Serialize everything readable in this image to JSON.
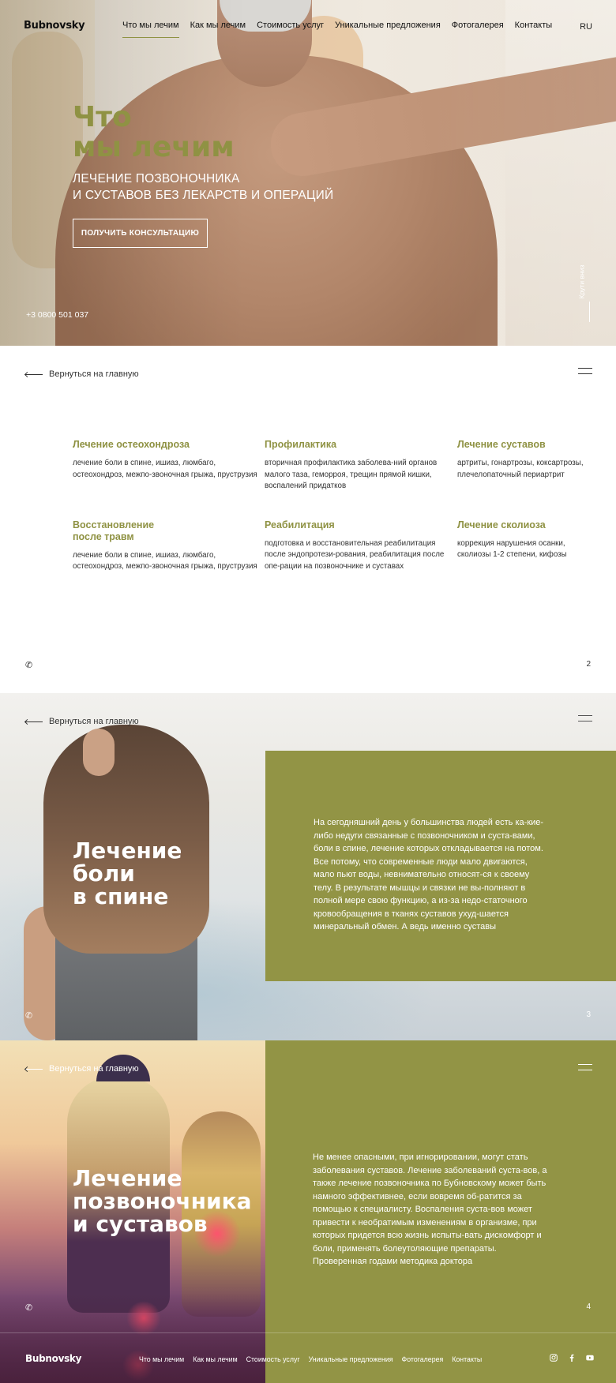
{
  "brand": {
    "logo": "Bubnovsky",
    "accent": "#929445"
  },
  "nav": {
    "items": [
      "Что мы лечим",
      "Как мы лечим",
      "Стоимость услуг",
      "Уникальные предложения",
      "Фотогалерея",
      "Контакты"
    ],
    "active_index": 0,
    "lang": "RU"
  },
  "hero": {
    "title_line1": "Что",
    "title_line2": "мы лечим",
    "subtitle_line1": "ЛЕЧЕНИЕ ПОЗВОНОЧНИКА",
    "subtitle_line2": "И СУСТАВОВ БЕЗ ЛЕКАРСТВ И ОПЕРАЦИЙ",
    "cta": "ПОЛУЧИТЬ КОНСУЛЬТАЦИЮ",
    "phone": "+3 0800 501 037",
    "scroll_label": "Крути вниз"
  },
  "back_link": "Вернуться на главную",
  "services": {
    "page": "2",
    "items": [
      {
        "title": "Лечение остеохондроза",
        "text": "лечение боли в спине, ишиаз, люмбаго, остеохондроз, межпо-звоночная грыжа, пруструзия"
      },
      {
        "title": "Профилактика",
        "text": "вторичная профилактика заболева-ний органов малого таза, геморроя, трещин прямой кишки, воспалений придатков"
      },
      {
        "title": "Лечение суставов",
        "text": "артриты, гонартрозы, коксартрозы, плечелопаточный периартрит"
      },
      {
        "title": "Восстановление после травм",
        "text": "лечение боли в спине, ишиаз, люмбаго, остеохондроз, межпо-звоночная грыжа, пруструзия"
      },
      {
        "title": "Реабилитация",
        "text": "подготовка и восстановительная реабилитация после эндопротези-рования, реабилитация после опе-рации на позвоночнике и суставах"
      },
      {
        "title": "Лечение сколиоза",
        "text": "коррекция нарушения осанки, сколиозы 1-2 степени, кифозы"
      }
    ]
  },
  "back_pain": {
    "page": "3",
    "title_line1": "Лечение",
    "title_line2": "боли",
    "title_line3": "в спине",
    "text": "На сегодняшний день у большинства людей есть ка-кие-либо недуги связанные с позвоночником и суста-вами, боли в спине, лечение которых откладывается на потом. Все потому, что современные люди мало двигаются, мало пьют воды, невнимательно относят-ся к своему телу. В результате мышцы и связки не вы-полняют в полной мере свою функцию, а из-за недо-статочного кровообращения в тканях суставов ухуд-шается минеральный обмен. А ведь именно суставы"
  },
  "spine": {
    "page": "4",
    "title_line1": "Лечение",
    "title_line2": "позвоночника",
    "title_line3": "и суставов",
    "text": "Не менее опасными, при игнорировании, могут стать заболевания суставов. Лечение заболеваний суста-вов, а также лечение позвоночника по Бубновскому может быть намного эффективнее, если вовремя об-ратится за помощью к специалисту. Воспаления суста-вов может привести к необратимым изменениям в организме, при которых придется всю жизнь испыты-вать дискомфорт и боли, применять болеутоляющие препараты. Проверенная годами методика доктора"
  },
  "footer": {
    "logo": "Bubnovsky",
    "links": [
      "Что мы лечим",
      "Как мы лечим",
      "Стоимость услуг",
      "Уникальные предложения",
      "Фотогалерея",
      "Контакты"
    ],
    "social": [
      "instagram-icon",
      "facebook-icon",
      "youtube-icon"
    ]
  }
}
